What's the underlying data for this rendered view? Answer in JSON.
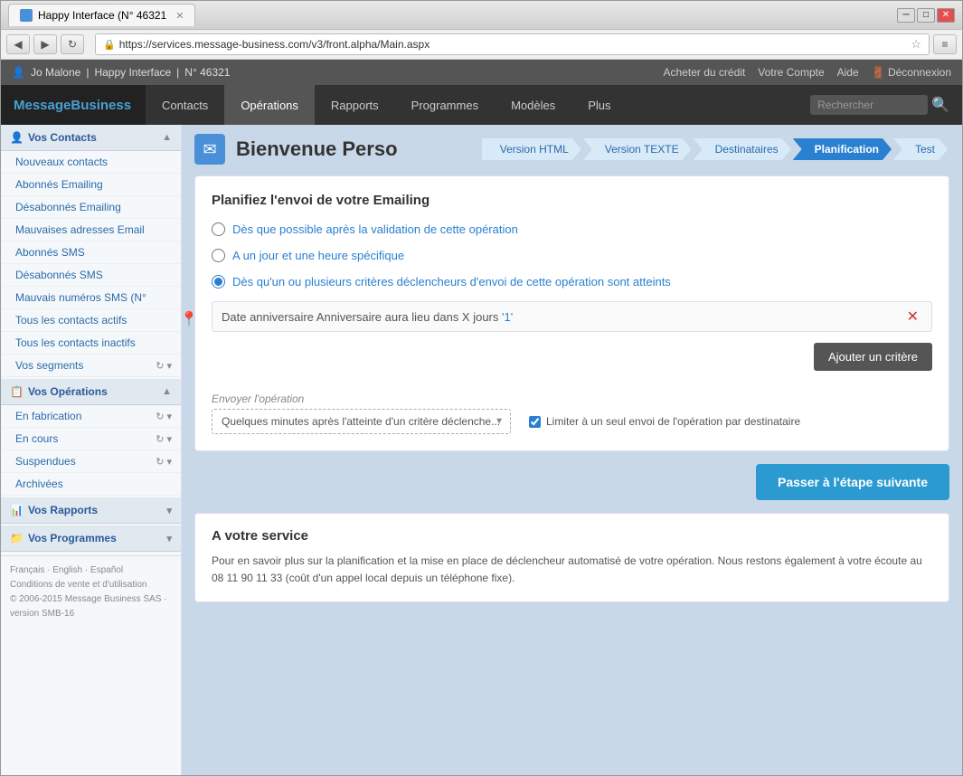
{
  "browser": {
    "tab_title": "Happy Interface (N° 46321",
    "address": "https://services.message-business.com/v3/front.alpha/Main.aspx",
    "window_buttons": {
      "minimize": "─",
      "maximize": "□",
      "close": "✕"
    }
  },
  "app_header": {
    "user": "Jo Malone",
    "separator1": "|",
    "brand": "Happy Interface",
    "separator2": "|",
    "ref": "N° 46321",
    "buy_credit": "Acheter du crédit",
    "account": "Votre Compte",
    "help": "Aide",
    "logout": "Déconnexion"
  },
  "nav": {
    "logo": "MessageBusiness",
    "items": [
      {
        "label": "Contacts",
        "active": false
      },
      {
        "label": "Opérations",
        "active": true
      },
      {
        "label": "Rapports",
        "active": false
      },
      {
        "label": "Programmes",
        "active": false
      },
      {
        "label": "Modèles",
        "active": false
      },
      {
        "label": "Plus",
        "active": false
      }
    ],
    "search_placeholder": "Rechercher"
  },
  "sidebar": {
    "sections": [
      {
        "id": "contacts",
        "title": "Vos Contacts",
        "icon": "👤",
        "items": [
          {
            "label": "Nouveaux contacts",
            "actions": false
          },
          {
            "label": "Abonnés Emailing",
            "actions": false
          },
          {
            "label": "Désabonnés Emailing",
            "actions": false
          },
          {
            "label": "Mauvaises adresses Email",
            "actions": false
          },
          {
            "label": "Abonnés SMS",
            "actions": false
          },
          {
            "label": "Désabonnés SMS",
            "actions": false
          },
          {
            "label": "Mauvais numéros SMS (N°",
            "actions": false
          },
          {
            "label": "Tous les contacts actifs",
            "actions": false
          },
          {
            "label": "Tous les contacts inactifs",
            "actions": false
          },
          {
            "label": "Vos segments",
            "actions": true
          }
        ]
      },
      {
        "id": "operations",
        "title": "Vos Opérations",
        "icon": "📋",
        "items": [
          {
            "label": "En fabrication",
            "actions": true
          },
          {
            "label": "En cours",
            "actions": true
          },
          {
            "label": "Suspendues",
            "actions": true
          },
          {
            "label": "Archivées",
            "actions": false
          }
        ]
      },
      {
        "id": "rapports",
        "title": "Vos Rapports",
        "icon": "📊",
        "items": []
      },
      {
        "id": "programmes",
        "title": "Vos Programmes",
        "icon": "📁",
        "items": []
      }
    ],
    "footer": {
      "line1": "Français · English · Español",
      "line2": "Conditions de vente et d'utilisation",
      "line3": "© 2006-2015 Message Business SAS · version SMB-16"
    }
  },
  "page": {
    "title": "Bienvenue Perso",
    "icon": "✉",
    "breadcrumbs": [
      {
        "label": "Version HTML",
        "active": false
      },
      {
        "label": "Version TEXTE",
        "active": false
      },
      {
        "label": "Destinataires",
        "active": false
      },
      {
        "label": "Planification",
        "active": true
      },
      {
        "label": "Test",
        "active": false
      }
    ],
    "card_title": "Planifiez l'envoi de votre Emailing",
    "radio_options": [
      {
        "id": "opt1",
        "label": "Dès que possible après la validation de cette opération",
        "checked": false
      },
      {
        "id": "opt2",
        "label": "A un jour et une heure spécifique",
        "checked": false
      },
      {
        "id": "opt3",
        "label": "Dès qu'un ou plusieurs critères déclencheurs d'envoi de cette opération sont atteints",
        "checked": true
      }
    ],
    "criteria": [
      {
        "text_before": "Date anniversaire Anniversaire aura lieu dans X jours ",
        "highlight": "'1'"
      }
    ],
    "add_criteria_btn": "Ajouter un critère",
    "send_label": "Envoyer l'opération",
    "send_options": [
      "Quelques minutes après l'atteinte d'un critère déclenche..."
    ],
    "send_selected": "Quelques minutes après l'atteinte d'un critère déclenche...",
    "limit_checkbox_label": "Limiter à un seul envoi de l'opération par destinataire",
    "limit_checked": true,
    "next_btn": "Passer à l'étape suivante",
    "service_title": "A votre service",
    "service_text": "Pour en savoir plus sur la planification et la mise en place de déclencheur automatisé de votre opération. Nous restons également à votre écoute au 08 11 90 11 33 (coût d'un appel local depuis un téléphone fixe)."
  }
}
